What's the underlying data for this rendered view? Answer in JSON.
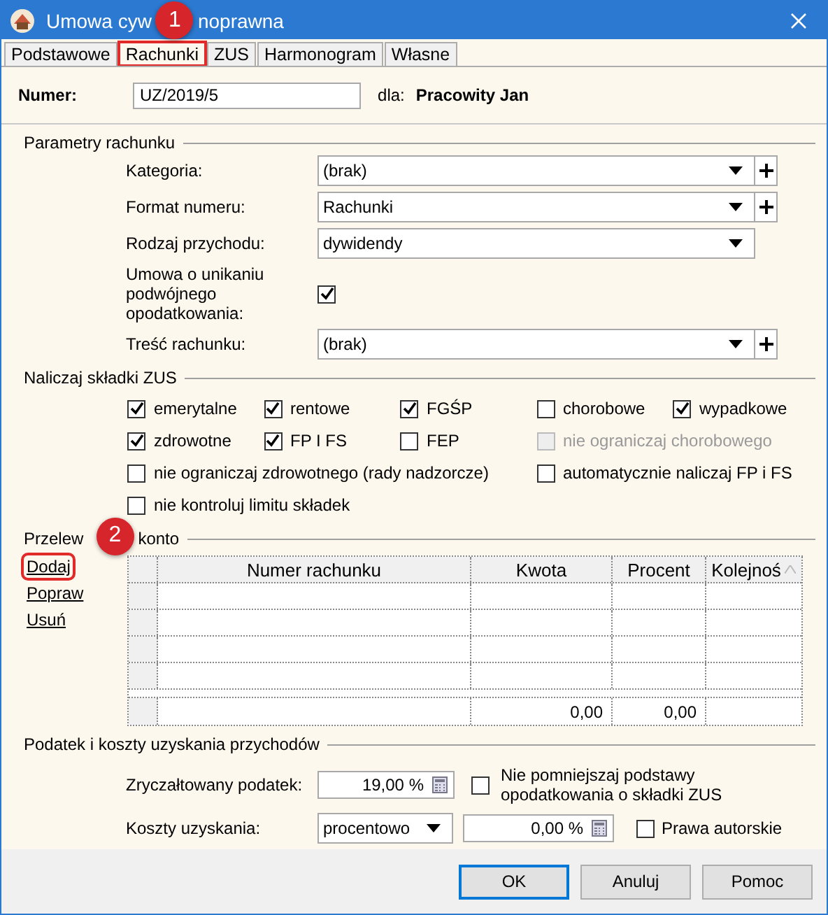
{
  "window": {
    "title_parts": [
      "Umowa cyw",
      "noprawna"
    ]
  },
  "tabs": [
    {
      "label": "Podstawowe",
      "selected": false,
      "highlighted": false
    },
    {
      "label": "Rachunki",
      "selected": true,
      "highlighted": true
    },
    {
      "label": "ZUS",
      "selected": false,
      "highlighted": false
    },
    {
      "label": "Harmonogram",
      "selected": false,
      "highlighted": false
    },
    {
      "label": "Własne",
      "selected": false,
      "highlighted": false
    }
  ],
  "annotations": [
    {
      "label": "1"
    },
    {
      "label": "2"
    }
  ],
  "number": {
    "label": "Numer:",
    "value": "UZ/2019/5",
    "for_label": "dla:",
    "for_value": "Pracowity Jan"
  },
  "invoice_params": {
    "title": "Parametry rachunku",
    "fields": [
      {
        "kind": "dropdown",
        "label": "Kategoria:",
        "value": "(brak)",
        "add": true
      },
      {
        "kind": "dropdown",
        "label": "Format numeru:",
        "value": "Rachunki",
        "add": true
      },
      {
        "kind": "dropdown",
        "label": "Rodzaj przychodu:",
        "value": "dywidendy",
        "add": false
      },
      {
        "kind": "checkbox",
        "label": "Umowa o unikaniu podwójnego opodatkowania:",
        "checked": true
      },
      {
        "kind": "dropdown",
        "label": "Treść rachunku:",
        "value": "(brak)",
        "add": true
      }
    ]
  },
  "zus": {
    "title": "Naliczaj składki ZUS",
    "rows": [
      [
        {
          "label": "emerytalne",
          "checked": true,
          "disabled": false
        },
        {
          "label": "rentowe",
          "checked": true,
          "disabled": false
        },
        {
          "label": "FGŚP",
          "checked": true,
          "disabled": false
        },
        {
          "label": "chorobowe",
          "checked": false,
          "disabled": false
        },
        {
          "label": "wypadkowe",
          "checked": true,
          "disabled": false
        }
      ],
      [
        {
          "label": "zdrowotne",
          "checked": true,
          "disabled": false
        },
        {
          "label": "FP I FS",
          "checked": true,
          "disabled": false
        },
        {
          "label": "FEP",
          "checked": false,
          "disabled": false
        },
        {
          "label": "nie ograniczaj chorobowego",
          "checked": false,
          "disabled": true
        },
        null
      ],
      [
        {
          "label": "nie ograniczaj zdrowotnego (rady nadzorcze)",
          "checked": false,
          "disabled": false
        },
        null,
        null,
        {
          "label": "automatycznie naliczaj FP i FS",
          "checked": false,
          "disabled": false
        },
        null
      ],
      [
        {
          "label": "nie kontroluj limitu składek",
          "checked": false,
          "disabled": false
        },
        null,
        null,
        null,
        null
      ]
    ]
  },
  "transfer": {
    "title_parts": [
      "Przelew",
      "konto"
    ],
    "links": [
      {
        "label": "Dodaj",
        "highlighted": true
      },
      {
        "label": "Popraw",
        "highlighted": false
      },
      {
        "label": "Usuń",
        "highlighted": false
      }
    ],
    "columns": [
      "Numer rachunku",
      "Kwota",
      "Procent",
      "Kolejnoś"
    ],
    "totals": {
      "amount": "0,00",
      "percent": "0,00"
    }
  },
  "tax": {
    "title": "Podatek i koszty uzyskania przychodów",
    "flat_tax": {
      "label": "Zryczałtowany podatek:",
      "value": "19,00 %"
    },
    "no_reduce": {
      "label": "Nie pomniejszaj podstawy opodatkowania o składki ZUS",
      "checked": false
    },
    "costs": {
      "label": "Koszty uzyskania:",
      "mode": "procentowo",
      "value": "0,00 %"
    },
    "copyright": {
      "label": "Prawa autorskie",
      "checked": false
    }
  },
  "buttons": [
    {
      "label": "OK",
      "default": true
    },
    {
      "label": "Anuluj",
      "default": false
    },
    {
      "label": "Pomoc",
      "default": false
    }
  ]
}
